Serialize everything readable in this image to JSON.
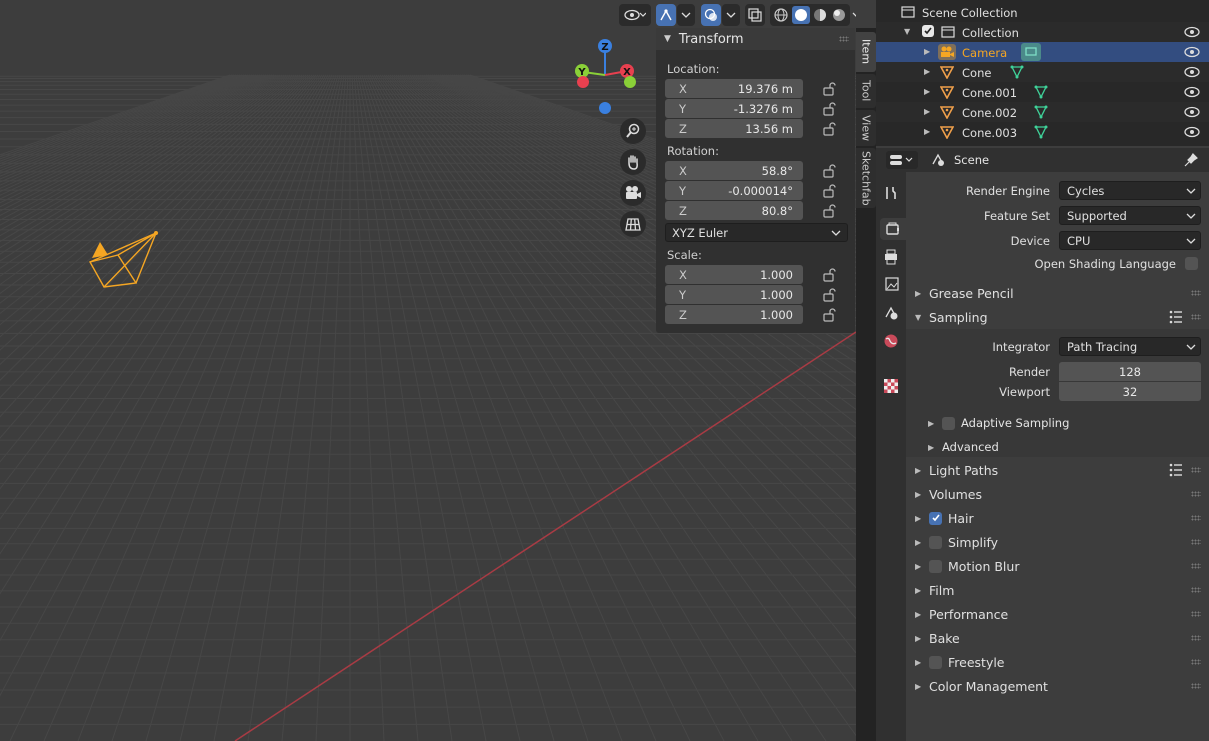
{
  "viewport_header": {
    "shading_modes": [
      "wireframe",
      "solid",
      "material",
      "rendered"
    ],
    "icons": [
      "eye-icon",
      "gizmo-icon",
      "overlay-icon",
      "xray-icon"
    ]
  },
  "gizmo": {
    "z": "Z",
    "y": "Y",
    "x": "X"
  },
  "npanel": {
    "title": "Transform",
    "location_label": "Location:",
    "location": [
      {
        "axis": "X",
        "value": "19.376 m"
      },
      {
        "axis": "Y",
        "value": "-1.3276 m"
      },
      {
        "axis": "Z",
        "value": "13.56 m"
      }
    ],
    "rotation_label": "Rotation:",
    "rotation": [
      {
        "axis": "X",
        "value": "58.8°"
      },
      {
        "axis": "Y",
        "value": "-0.000014°"
      },
      {
        "axis": "Z",
        "value": "80.8°"
      }
    ],
    "rotation_mode": "XYZ Euler",
    "scale_label": "Scale:",
    "scale": [
      {
        "axis": "X",
        "value": "1.000"
      },
      {
        "axis": "Y",
        "value": "1.000"
      },
      {
        "axis": "Z",
        "value": "1.000"
      }
    ]
  },
  "side_tabs": [
    "Item",
    "Tool",
    "View",
    "Sketchfab"
  ],
  "outliner": {
    "root": "Scene Collection",
    "collection": "Collection",
    "items": [
      {
        "name": "Camera",
        "selected": true
      },
      {
        "name": "Cone",
        "selected": false
      },
      {
        "name": "Cone.001",
        "selected": false
      },
      {
        "name": "Cone.002",
        "selected": false
      },
      {
        "name": "Cone.003",
        "selected": false
      }
    ]
  },
  "properties": {
    "context": "Scene",
    "render_engine_label": "Render Engine",
    "render_engine": "Cycles",
    "feature_set_label": "Feature Set",
    "feature_set": "Supported",
    "device_label": "Device",
    "device": "CPU",
    "osl_label": "Open Shading Language",
    "panels": {
      "grease_pencil": "Grease Pencil",
      "sampling": "Sampling",
      "integrator_label": "Integrator",
      "integrator": "Path Tracing",
      "render_label": "Render",
      "render_samples": "128",
      "viewport_label": "Viewport",
      "viewport_samples": "32",
      "adaptive_sampling": "Adaptive Sampling",
      "advanced": "Advanced",
      "light_paths": "Light Paths",
      "volumes": "Volumes",
      "hair": "Hair",
      "simplify": "Simplify",
      "motion_blur": "Motion Blur",
      "film": "Film",
      "performance": "Performance",
      "bake": "Bake",
      "freestyle": "Freestyle",
      "color_management": "Color Management"
    }
  },
  "colors": {
    "accent": "#4772b3",
    "selected_row": "#334d80",
    "camera_orange": "#f5a623",
    "x_axis": "#e8404f",
    "y_axis": "#8ad038",
    "z_axis": "#3a80e0"
  }
}
